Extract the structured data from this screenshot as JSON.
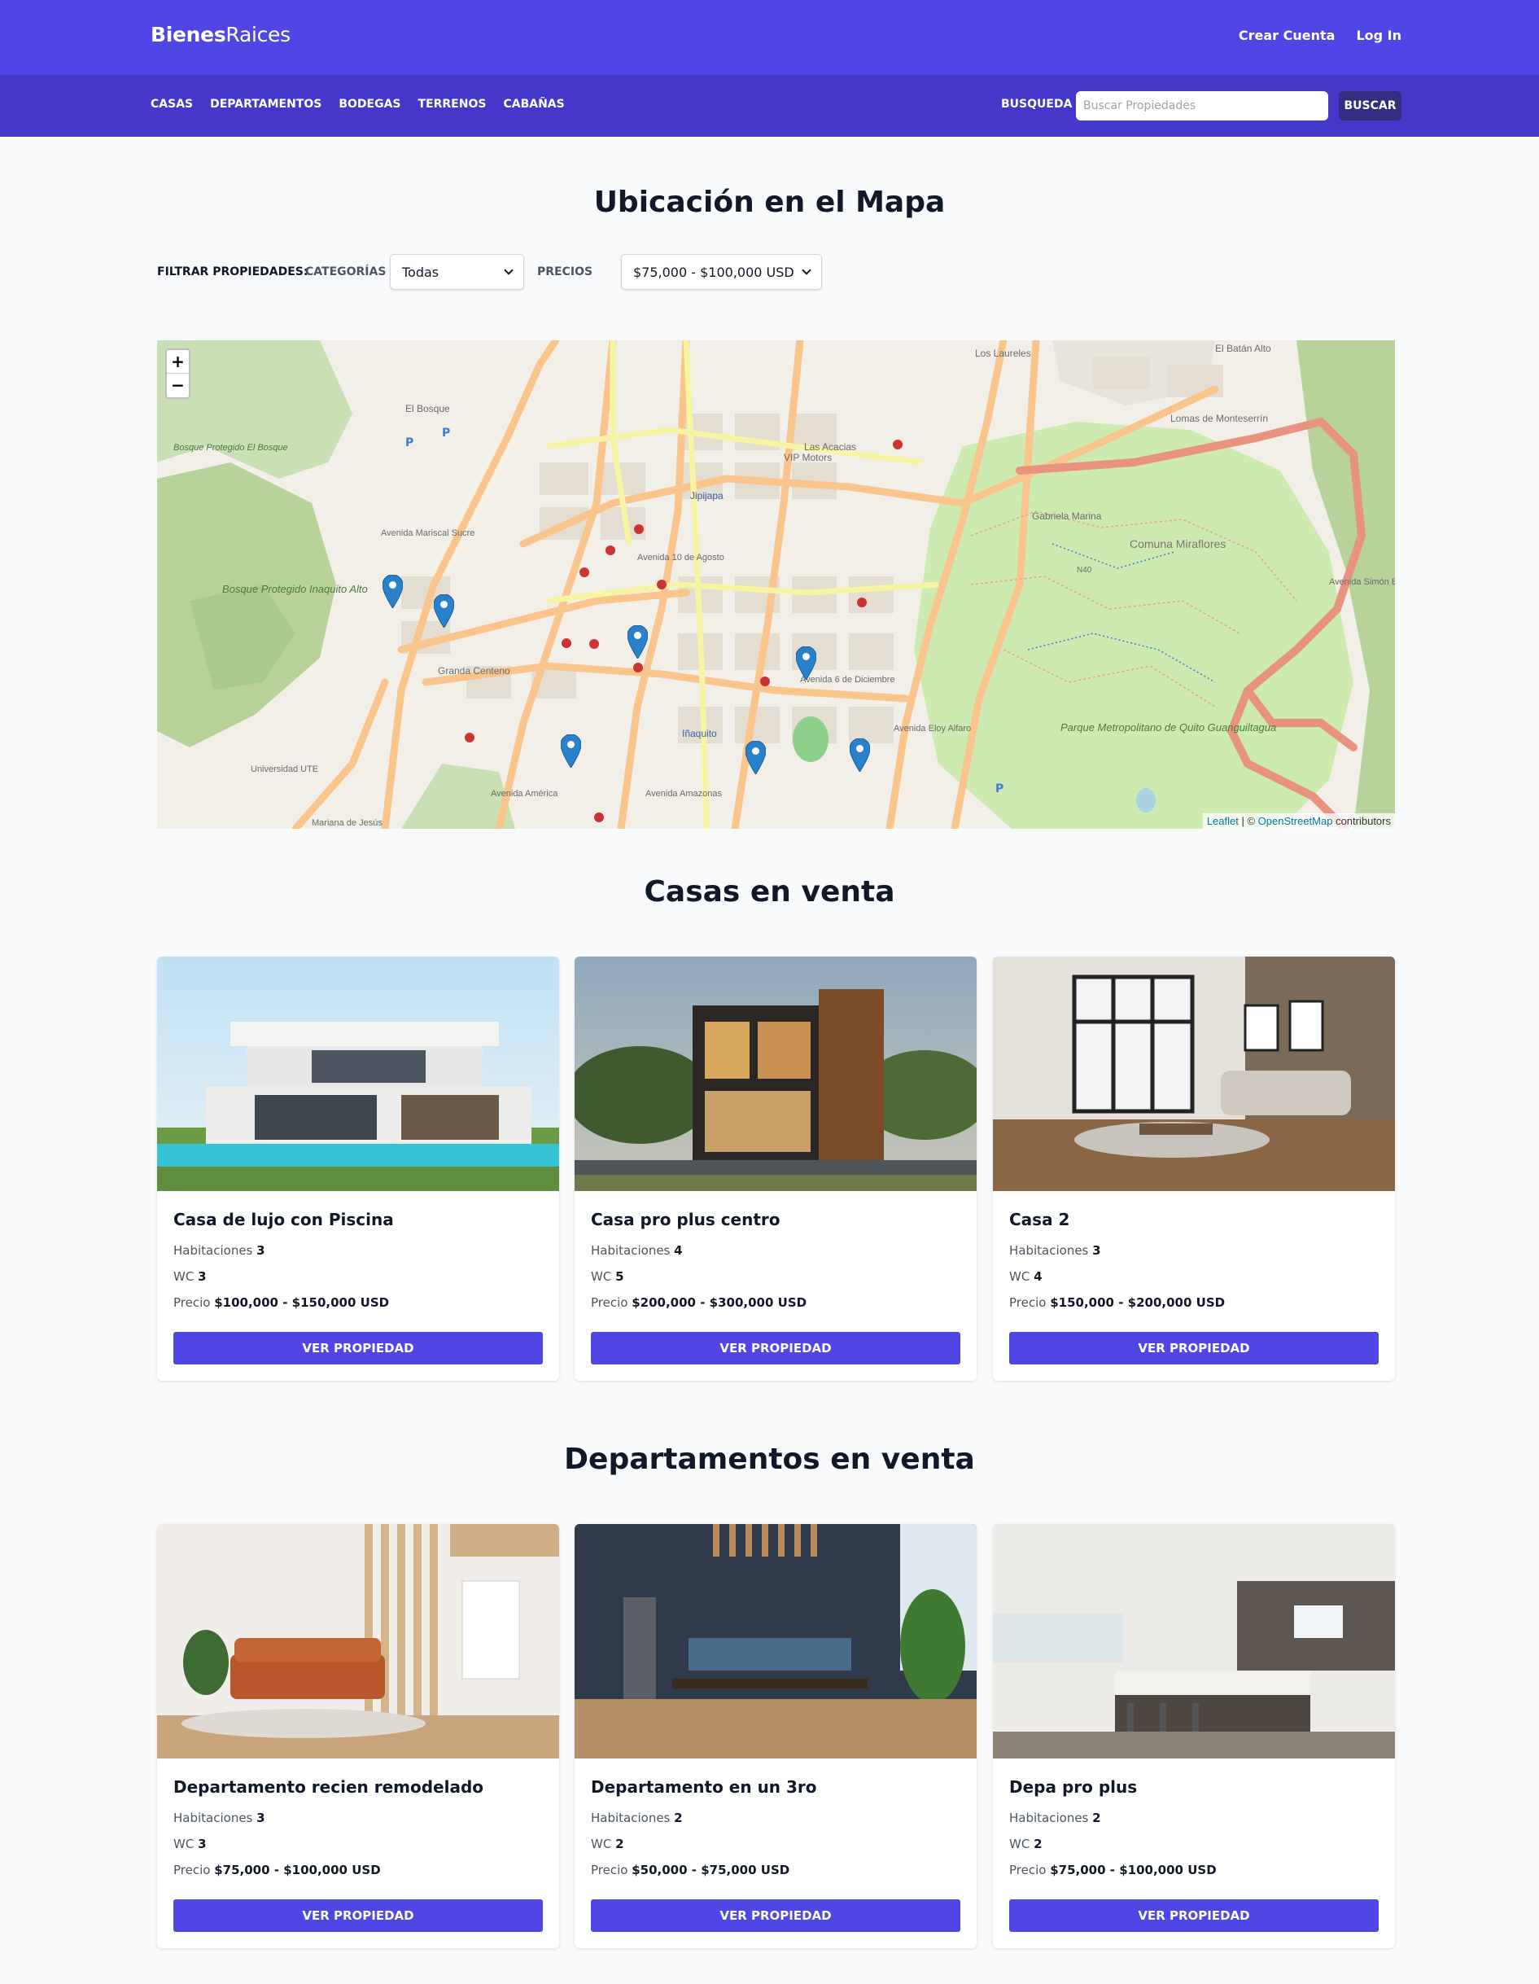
{
  "header": {
    "logo_bold": "Bienes",
    "logo_light": "Raices",
    "links": [
      "Crear Cuenta",
      "Log In"
    ]
  },
  "nav": {
    "categories": [
      "CASAS",
      "DEPARTAMENTOS",
      "BODEGAS",
      "TERRENOS",
      "CABAÑAS"
    ],
    "search_label": "BUSQUEDA",
    "search_placeholder": "Buscar Propiedades",
    "search_button": "BUSCAR"
  },
  "map_section": {
    "title": "Ubicación en el Mapa",
    "filter_label": "FILTRAR PROPIEDADES:",
    "category_label": "CATEGORÍAS",
    "category_value": "Todas",
    "price_label": "PRECIOS",
    "price_value": "$75,000 - $100,000 USD"
  },
  "map": {
    "zoom_in": "+",
    "zoom_out": "−",
    "attribution_leaflet": "Leaflet",
    "attribution_sep": " | © ",
    "attribution_osm": "OpenStreetMap",
    "attribution_tail": " contributors",
    "labels": [
      "Los Laureles",
      "El Batán Alto",
      "El Bosque",
      "Bosque Protegido El Bosque",
      "Lomas de Monteserrín",
      "Las Acacias",
      "Jipijapa",
      "VIP Motors",
      "Gabriela Marina",
      "Comuna Miraflores",
      "Bosque Protegido Inaquito Alto",
      "Granda Centeno",
      "Iñaquito",
      "Parque Metropolitano de Quito Guanguiltagua",
      "Universidad UTE",
      "Avenida Mariscal Sucre",
      "Avenida 10 de Agosto",
      "Avenida América",
      "Avenida Amazonas",
      "Avenida 6 de Diciembre",
      "Avenida Eloy Alfaro",
      "Avenida Simón Bolívar",
      "N40",
      "Mariana de Jesús"
    ]
  },
  "houses": {
    "title": "Casas en venta",
    "items": [
      {
        "name": "Casa de lujo con Piscina",
        "rooms_label": "Habitaciones",
        "rooms": "3",
        "wc_label": "WC",
        "wc": "3",
        "price_label": "Precio",
        "price": "$100,000 - $150,000 USD",
        "button": "VER PROPIEDAD"
      },
      {
        "name": "Casa pro plus centro",
        "rooms_label": "Habitaciones",
        "rooms": "4",
        "wc_label": "WC",
        "wc": "5",
        "price_label": "Precio",
        "price": "$200,000 - $300,000 USD",
        "button": "VER PROPIEDAD"
      },
      {
        "name": "Casa 2",
        "rooms_label": "Habitaciones",
        "rooms": "3",
        "wc_label": "WC",
        "wc": "4",
        "price_label": "Precio",
        "price": "$150,000 - $200,000 USD",
        "button": "VER PROPIEDAD"
      }
    ]
  },
  "apartments": {
    "title": "Departamentos en venta",
    "items": [
      {
        "name": "Departamento recien remodelado",
        "rooms_label": "Habitaciones",
        "rooms": "3",
        "wc_label": "WC",
        "wc": "3",
        "price_label": "Precio",
        "price": "$75,000 - $100,000 USD",
        "button": "VER PROPIEDAD"
      },
      {
        "name": "Departamento en un 3ro",
        "rooms_label": "Habitaciones",
        "rooms": "2",
        "wc_label": "WC",
        "wc": "2",
        "price_label": "Precio",
        "price": "$50,000 - $75,000 USD",
        "button": "VER PROPIEDAD"
      },
      {
        "name": "Depa pro plus",
        "rooms_label": "Habitaciones",
        "rooms": "2",
        "wc_label": "WC",
        "wc": "2",
        "price_label": "Precio",
        "price": "$75,000 - $100,000 USD",
        "button": "VER PROPIEDAD"
      }
    ]
  },
  "colors": {
    "primary": "#4f46e5",
    "nav": "#4338ca",
    "search_button": "#312e81",
    "marker": "#2a81cb"
  }
}
